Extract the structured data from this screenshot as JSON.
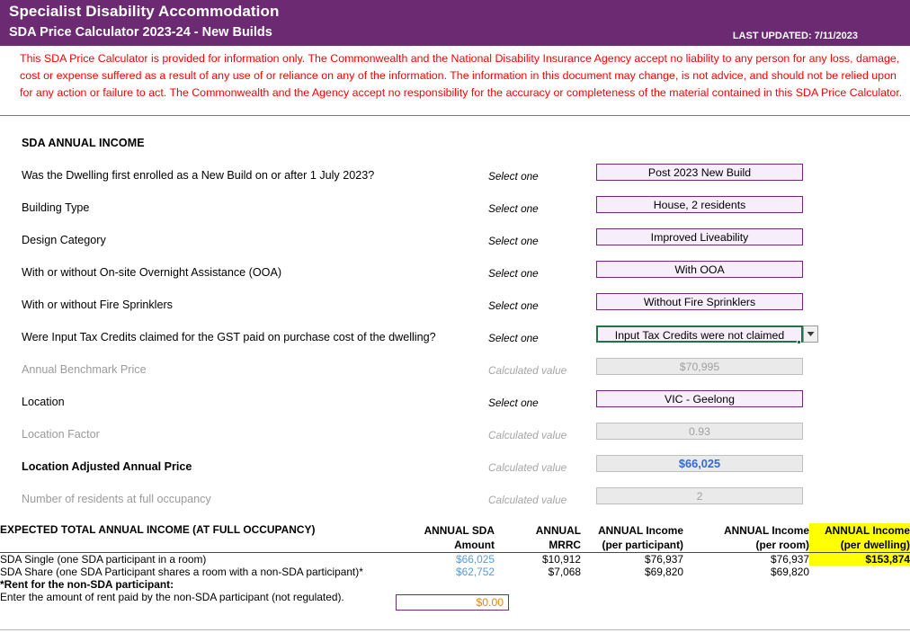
{
  "header": {
    "title": "Specialist Disability Accommodation",
    "subtitle": "SDA Price Calculator 2023-24 - New Builds",
    "last_updated": "LAST UPDATED: 7/11/2023",
    "banner_color": "#6B2A72"
  },
  "disclaimer": "This SDA Price Calculator is provided for information only.  The Commonwealth and the National Disability Insurance Agency accept no liability to any person for any loss, damage, cost or expense suffered as a result of any use of or reliance on any of the information.  The information in this document may change, is not advice, and should not be relied upon for any action or failure to act. The Commonwealth and the Agency accept no responsibility for the accuracy or completeness of the material contained in this SDA Price Calculator.",
  "section": {
    "title": "SDA ANNUAL INCOME"
  },
  "labels": {
    "select_one": "Select one",
    "calculated_value": "Calculated value"
  },
  "rows": [
    {
      "label": "Was the Dwelling first enrolled as a New Build on or after 1 July 2023?",
      "kind": "Select one",
      "value": "Post 2023 New Build",
      "type": "select"
    },
    {
      "label": "Building Type",
      "kind": "Select one",
      "value": "House, 2 residents",
      "type": "select"
    },
    {
      "label": "Design Category",
      "kind": "Select one",
      "value": "Improved Liveability",
      "type": "select"
    },
    {
      "label": "With or without On-site Overnight Assistance (OOA)",
      "kind": "Select one",
      "value": "With OOA",
      "type": "select"
    },
    {
      "label": "With or without Fire Sprinklers",
      "kind": "Select one",
      "value": "Without Fire Sprinklers",
      "type": "select"
    },
    {
      "label": "Were Input Tax Credits claimed for the GST paid on purchase cost of the dwelling?",
      "kind": "Select one",
      "value": "Input Tax Credits were not claimed",
      "type": "select-active"
    },
    {
      "label": "Annual Benchmark Price",
      "kind": "Calculated value",
      "value": "$70,995",
      "type": "calc"
    },
    {
      "label": "Location",
      "kind": "Select one",
      "value": "VIC - Geelong",
      "type": "select"
    },
    {
      "label": "Location Factor",
      "kind": "Calculated value",
      "value": "0.93",
      "type": "calc"
    },
    {
      "label": "Location Adjusted Annual Price",
      "kind": "Calculated value",
      "value": "$66,025",
      "type": "calc-accent"
    },
    {
      "label": "Number of residents at full occupancy",
      "kind": "Calculated value",
      "value": "2",
      "type": "calc"
    }
  ],
  "table": {
    "title": "EXPECTED TOTAL ANNUAL INCOME (AT FULL OCCUPANCY)",
    "columns": [
      {
        "line1": "ANNUAL SDA",
        "line2": "Amount"
      },
      {
        "line1": "ANNUAL",
        "line2": "MRRC"
      },
      {
        "line1": "ANNUAL Income",
        "line2": "(per participant)"
      },
      {
        "line1": "ANNUAL Income",
        "line2": "(per room)"
      },
      {
        "line1": "ANNUAL Income",
        "line2": "(per dwelling)"
      }
    ],
    "rows": [
      {
        "desc": "SDA Single (one SDA participant in a room)",
        "sda_amount": "$66,025",
        "mrrc": "$10,912",
        "per_participant": "$76,937",
        "per_room": "$76,937",
        "per_dwelling": "$153,874"
      },
      {
        "desc": "SDA Share (one SDA Participant shares a room with a non-SDA participant)*",
        "sda_amount": "$62,752",
        "mrrc": "$7,068",
        "per_participant": "$69,820",
        "per_room": "$69,820",
        "per_dwelling": ""
      }
    ],
    "footnote_title": "*Rent for the non-SDA participant:",
    "footnote_label": "Enter the amount of rent paid by the non-SDA participant (not regulated).",
    "rent_value": "$0.00",
    "rent_placeholder": "$0.00",
    "highlight_color": "#FFFF00"
  }
}
